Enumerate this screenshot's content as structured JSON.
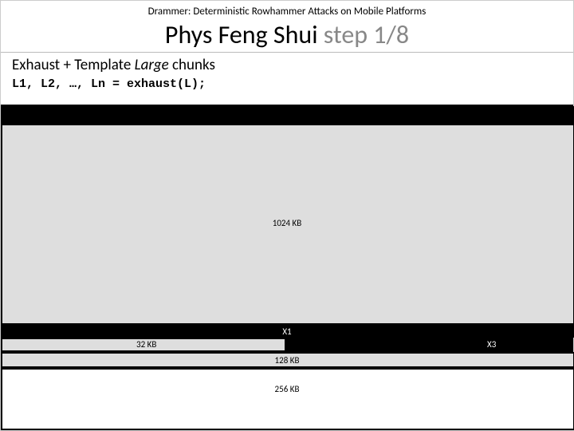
{
  "header": {
    "small": "Drammer: Deterministic Rowhammer Attacks on Mobile Platforms"
  },
  "title": {
    "prefix": "Phys Feng Shui ",
    "suffix": "step 1/8"
  },
  "subtitle": {
    "a": "Exhaust + Template ",
    "b": "Large ",
    "c": "chunks"
  },
  "code": "L1, L2, …, Ln = exhaust(L);",
  "labels": {
    "big": "1024 KB",
    "x1": "X1",
    "x3": "X3",
    "s32": "32 KB",
    "s128": "128 KB",
    "s256": "256 KB"
  }
}
